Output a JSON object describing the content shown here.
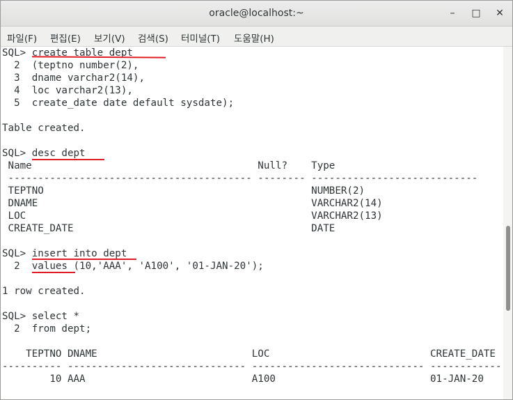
{
  "window": {
    "title": "oracle@localhost:~",
    "minimize_glyph": "–",
    "maximize_glyph": "□",
    "close_glyph": "✕"
  },
  "menu": {
    "items": [
      "파일(F)",
      "편집(E)",
      "보기(V)",
      "검색(S)",
      "터미널(T)",
      "도움말(H)"
    ]
  },
  "terminal": {
    "lines": [
      "SQL> create table dept",
      "  2  (teptno number(2),",
      "  3  dname varchar2(14),",
      "  4  loc varchar2(13),",
      "  5  create_date date default sysdate);",
      "",
      "Table created.",
      "",
      "SQL> desc dept",
      " Name                                      Null?    Type",
      " ----------------------------------------- -------- ----------------------------",
      " TEPTNO                                             NUMBER(2)",
      " DNAME                                              VARCHAR2(14)",
      " LOC                                                VARCHAR2(13)",
      " CREATE_DATE                                        DATE",
      "",
      "SQL> insert into dept",
      "  2  values (10,'AAA', 'A100', '01-JAN-20');",
      "",
      "1 row created.",
      "",
      "SQL> select *",
      "  2  from dept;",
      "",
      "    TEPTNO DNAME                          LOC                           CREATE_DATE",
      "---------- ------------------------------ ----------------------------- ------------",
      "        10 AAA                            A100                          01-JAN-20"
    ]
  },
  "colors": {
    "underline": "#e01b24",
    "text": "#2e3436",
    "background": "#ffffff"
  }
}
